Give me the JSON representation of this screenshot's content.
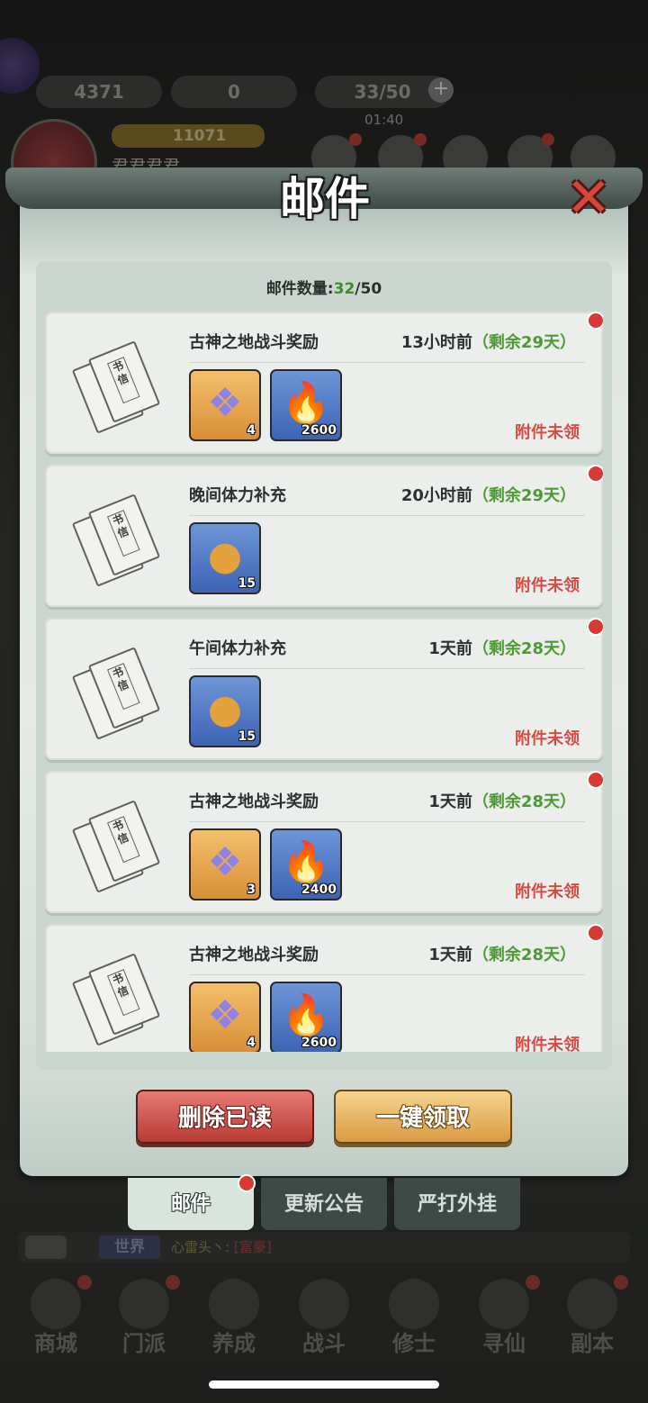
{
  "hud": {
    "gems": "4371",
    "gold": "0",
    "stamina": "33/50",
    "timer": "01:40",
    "power": "11071",
    "player_name": "君君君君"
  },
  "mail_panel": {
    "title": "邮件",
    "count_label": "邮件数量:",
    "count_current": "32",
    "count_max": "/50",
    "mails": [
      {
        "title": "古神之地战斗奖励",
        "time": "13小时前",
        "remain": "（剩余29天）",
        "status": "附件未领",
        "items": [
          {
            "kind": "token",
            "qty": "4"
          },
          {
            "kind": "flame",
            "qty": "2600"
          }
        ]
      },
      {
        "title": "晚间体力补充",
        "time": "20小时前",
        "remain": "（剩余29天）",
        "status": "附件未领",
        "items": [
          {
            "kind": "gourd",
            "qty": "15"
          }
        ]
      },
      {
        "title": "午间体力补充",
        "time": "1天前",
        "remain": "（剩余28天）",
        "status": "附件未领",
        "items": [
          {
            "kind": "gourd",
            "qty": "15"
          }
        ]
      },
      {
        "title": "古神之地战斗奖励",
        "time": "1天前",
        "remain": "（剩余28天）",
        "status": "附件未领",
        "items": [
          {
            "kind": "token",
            "qty": "3"
          },
          {
            "kind": "flame",
            "qty": "2400"
          }
        ]
      },
      {
        "title": "古神之地战斗奖励",
        "time": "1天前",
        "remain": "（剩余28天）",
        "status": "附件未领",
        "items": [
          {
            "kind": "token",
            "qty": "4"
          },
          {
            "kind": "flame",
            "qty": "2600"
          }
        ]
      }
    ],
    "delete_read_label": "删除已读",
    "claim_all_label": "一键领取",
    "tabs": [
      "邮件",
      "更新公告",
      "严打外挂"
    ]
  },
  "chat": {
    "channel": "世界",
    "message": "心雷头丶:",
    "tag": "[富豪]"
  },
  "bottom_nav": [
    "商城",
    "门派",
    "养成",
    "战斗",
    "修士",
    "寻仙",
    "副本"
  ],
  "colors": {
    "unread_dot": "#d73a34",
    "remain_green": "#4d9a35",
    "status_red": "#d54c45"
  }
}
